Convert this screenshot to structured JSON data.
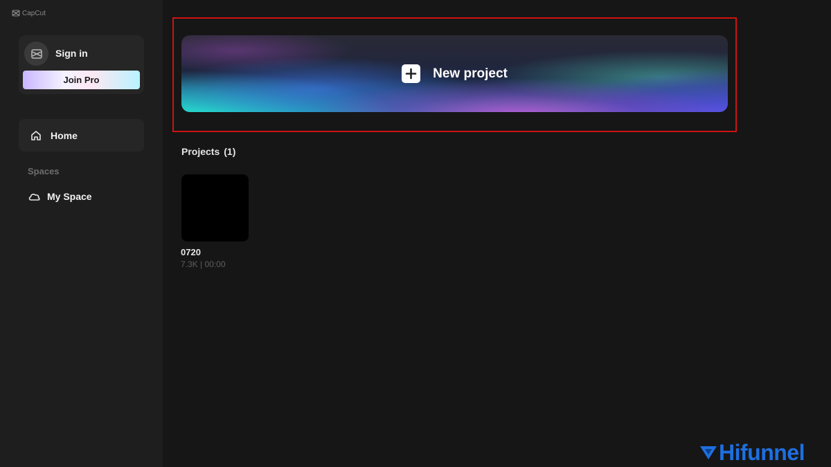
{
  "app": {
    "title": "CapCut"
  },
  "account": {
    "sign_in_label": "Sign in",
    "join_pro_label": "Join Pro"
  },
  "nav": {
    "home_label": "Home",
    "spaces_heading": "Spaces",
    "my_space_label": "My Space"
  },
  "main": {
    "new_project_label": "New project",
    "projects_heading": "Projects",
    "projects_count": "(1)",
    "projects": [
      {
        "name": "0720",
        "meta": "7.3K | 00:00"
      }
    ]
  },
  "watermark": {
    "text": "Hifunnel"
  },
  "colors": {
    "background": "#161616",
    "sidebar": "#1e1e1e",
    "highlight": "#d01212",
    "watermark": "#1e6fe0"
  },
  "icons": {
    "app_logo": "capcut-logo-icon",
    "avatar": "capcut-avatar-icon",
    "home": "home-icon",
    "my_space": "cloud-icon",
    "new_project": "plus-icon",
    "watermark_logo": "hifunnel-logo-icon"
  }
}
